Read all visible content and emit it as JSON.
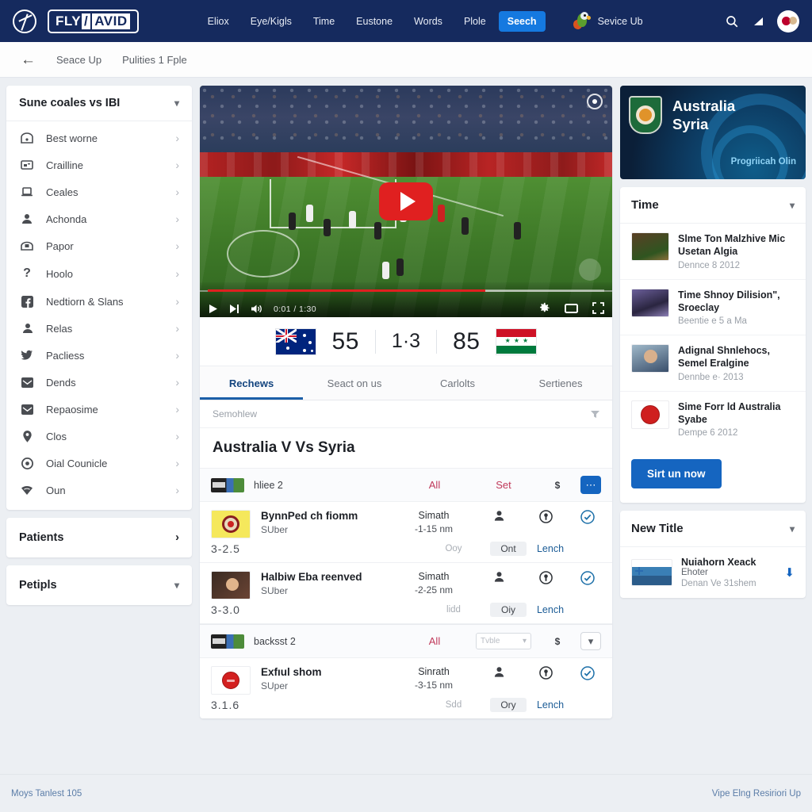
{
  "header": {
    "logo_text_1": "FLY",
    "logo_text_2": "/",
    "logo_text_3": "AVID",
    "nav": [
      {
        "label": "Eliox",
        "active": false
      },
      {
        "label": "Eye/Kigls",
        "active": false
      },
      {
        "label": "Time",
        "active": false
      },
      {
        "label": "Eustone",
        "active": false
      },
      {
        "label": "Words",
        "active": false
      },
      {
        "label": "Plole",
        "active": false
      },
      {
        "label": "Seech",
        "active": true
      }
    ],
    "service_label": "Sevice Ub",
    "icons": {
      "search": "search-icon",
      "signal": "signal-icon",
      "avatar": "avatar-flag-icon",
      "parrot": "parrot-mascot-icon"
    }
  },
  "breadcrumb": {
    "back": "←",
    "items": [
      "Seace Up",
      "Pulities 1 Fple"
    ]
  },
  "sidebar": {
    "title": "Sune coales vs IBI",
    "items": [
      {
        "label": "Best worne",
        "icon": "mailbox-icon"
      },
      {
        "label": "Crailline",
        "icon": "presentation-icon"
      },
      {
        "label": "Ceales",
        "icon": "laptop-icon"
      },
      {
        "label": "Achonda",
        "icon": "person-icon"
      },
      {
        "label": "Papor",
        "icon": "bag-icon"
      },
      {
        "label": "Hoolo",
        "icon": "question-icon"
      },
      {
        "label": "Nedtiorn & Slans",
        "icon": "facebook-icon"
      },
      {
        "label": "Relas",
        "icon": "user-icon"
      },
      {
        "label": "Pacliess",
        "icon": "twitter-icon"
      },
      {
        "label": "Dends",
        "icon": "envelope-icon"
      },
      {
        "label": "Repaosime",
        "icon": "mail-icon"
      },
      {
        "label": "Clos",
        "icon": "location-pin-icon"
      },
      {
        "label": "Oial Counicle",
        "icon": "target-icon"
      },
      {
        "label": "Oun",
        "icon": "wifi-icon"
      }
    ],
    "panels": [
      {
        "label": "Patients",
        "chevron": "right"
      },
      {
        "label": "Petipls",
        "chevron": "down"
      }
    ]
  },
  "video": {
    "time": "0:01 / 1:30",
    "play_icon": "play-button-icon",
    "controls": {
      "play": "play-icon",
      "next": "next-track-icon",
      "volume": "volume-icon",
      "settings": "gear-icon",
      "theater": "theater-mode-icon",
      "fullscreen": "fullscreen-icon"
    },
    "progress_percent": 70
  },
  "score": {
    "home_flag": "australia-flag",
    "away_flag": "syria-flag",
    "home_value": "55",
    "middle_value": "1·3",
    "away_value": "85"
  },
  "tabs": [
    {
      "label": "Rechews",
      "active": true
    },
    {
      "label": "Seact on us",
      "active": false
    },
    {
      "label": "Carlolts",
      "active": false
    },
    {
      "label": "Sertienes",
      "active": false
    }
  ],
  "list": {
    "filter_label": "Semohlew",
    "filter_icon": "filter-icon",
    "heading": "Australia V Vs Syria",
    "groups": [
      {
        "name": "hliee 2",
        "col_a": "All",
        "col_b": "Set",
        "money": "$",
        "button_icon": "more-horizontal-icon",
        "button_style": "filled",
        "has_select": false,
        "select_value": ""
      },
      {
        "name": "backsst 2",
        "col_a": "All",
        "col_b": "",
        "money": "$",
        "button_icon": "chevron-down-icon",
        "button_style": "outline",
        "has_select": true,
        "select_value": "Tvble"
      }
    ],
    "rows": [
      {
        "thumb": "yellow-crest-thumb",
        "title": "BynnPed ch fiomm",
        "sub": "SUber",
        "mid_top": "Simath",
        "mid_bottom": "-1-15 nm",
        "odds": "3-2.5",
        "foot_a": "Ooy",
        "foot_b": "Ont",
        "foot_c": "Lench",
        "icon_person": "person-icon",
        "icon_badge": "award-icon",
        "icon_check": "check-circle-icon",
        "group_index": 0
      },
      {
        "thumb": "dark-portrait-thumb",
        "title": "Halbiw Eba reenved",
        "sub": "SUber",
        "mid_top": "Simath",
        "mid_bottom": "-2-25 nm",
        "odds": "3-3.0",
        "foot_a": "lidd",
        "foot_b": "Oiy",
        "foot_c": "Lench",
        "icon_person": "person-icon",
        "icon_badge": "award-icon",
        "icon_check": "check-circle-icon",
        "group_index": 0
      },
      {
        "thumb": "red-ball-thumb",
        "title": "Exfıul shom",
        "sub": "SUper",
        "mid_top": "Sinrath",
        "mid_bottom": "-3-15 nm",
        "odds": "3.1.6",
        "foot_a": "Sdd",
        "foot_b": "Ory",
        "foot_c": "Lench",
        "icon_person": "person-icon",
        "icon_badge": "award-icon",
        "icon_check": "check-circle-icon",
        "group_index": 1
      }
    ]
  },
  "right_rail": {
    "promo": {
      "line1": "Australia",
      "line2": "Syria",
      "sub": "Progriicah Olin",
      "crest_icon": "australia-crest-icon"
    },
    "time_panel": {
      "title": "Time",
      "chevron": "down",
      "items": [
        {
          "title": "Slme Ton Malzhive Mic Usetan Algia",
          "date": "Dennce 8 2012",
          "thumb": "stadium-thumb"
        },
        {
          "title": "Time Shnoy Dilision\", Sroeclay",
          "date": "Beentie e 5 a Ma",
          "thumb": "crowd-thumb"
        },
        {
          "title": "Adignal Shnlehocs, Semel Eralgine",
          "date": "Dennbe e· 2013",
          "thumb": "portrait-thumb"
        },
        {
          "title": "Sime Forr ld Australia Syabe",
          "date": "Dempe 6 2012",
          "thumb": "red-crest-thumb"
        }
      ],
      "button_label": "Sirt un now"
    },
    "new_panel": {
      "title": "New Title",
      "chevron": "down",
      "item": {
        "title": "Nuiahorn Xeack",
        "sub": "Ehoter",
        "date": "Denan Ve 31shem",
        "thumb": "flag-doc-thumb",
        "action_icon": "download-icon"
      }
    }
  },
  "footer": {
    "left": "Moys Tanlest 105",
    "right": "Vipe Elng Resiriori Up"
  },
  "colors": {
    "nav_bg": "#152a5e",
    "accent_blue": "#1565c0",
    "tab_active": "#1c5fa8",
    "play_red": "#e02020",
    "grp_red": "#c0395a"
  }
}
